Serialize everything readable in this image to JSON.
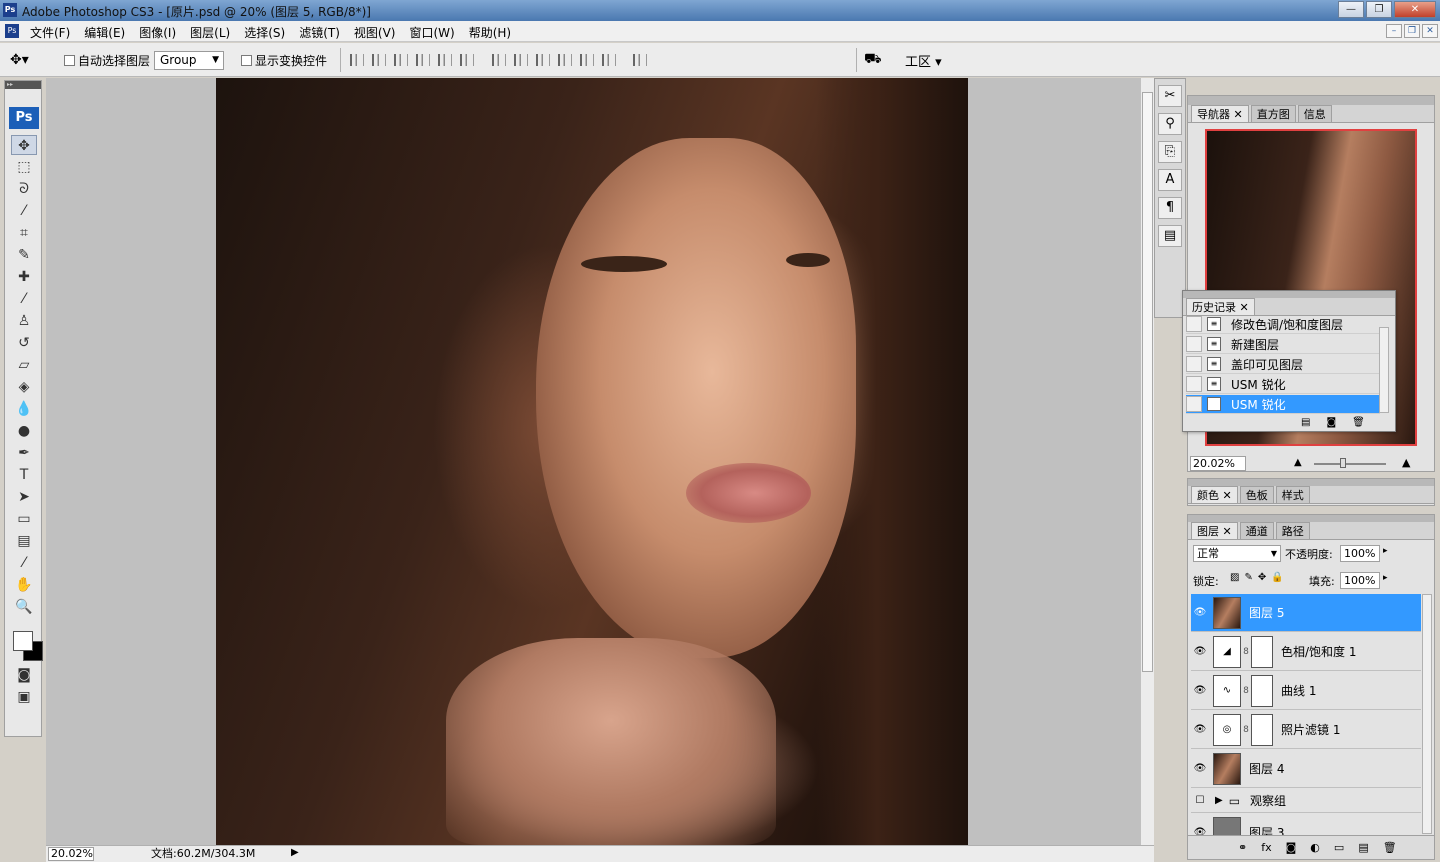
{
  "titlebar": {
    "app_icon": "Ps",
    "title": "Adobe Photoshop CS3 - [原片.psd @ 20% (图层 5, RGB/8*)]",
    "min": "—",
    "max": "❐",
    "close": "✕"
  },
  "menubar": {
    "doc_icon": "Ps",
    "items": [
      "文件(F)",
      "编辑(E)",
      "图像(I)",
      "图层(L)",
      "选择(S)",
      "滤镜(T)",
      "视图(V)",
      "窗口(W)",
      "帮助(H)"
    ],
    "min": "–",
    "restore": "❐",
    "close": "✕"
  },
  "options": {
    "auto_select_label": "自动选择图层",
    "auto_select_value": "Group",
    "show_transform_label": "显示变换控件",
    "workspace_label": "工区 ▾"
  },
  "status": {
    "zoom": "20.02%",
    "doc_info": "文档:60.2M/304.3M"
  },
  "navigator": {
    "tabs": [
      "导航器",
      "直方图",
      "信息"
    ],
    "zoom": "20.02%"
  },
  "history": {
    "tab": "历史记录",
    "items": [
      "修改色调/饱和度图层",
      "新建图层",
      "盖印可见图层",
      "USM 锐化",
      "USM 锐化"
    ],
    "selected_index": 4
  },
  "color_panel": {
    "tabs": [
      "颜色",
      "色板",
      "样式"
    ]
  },
  "layers_panel": {
    "tabs": [
      "图层",
      "通道",
      "路径"
    ],
    "blend_mode": "正常",
    "opacity_label": "不透明度:",
    "opacity_value": "100%",
    "lock_label": "锁定:",
    "fill_label": "填充:",
    "fill_value": "100%",
    "layers": [
      "图层 5",
      "色相/饱和度 1",
      "曲线 1",
      "照片滤镜 1",
      "图层 4",
      "观察组",
      "图层 3"
    ],
    "selected_index": 0
  }
}
